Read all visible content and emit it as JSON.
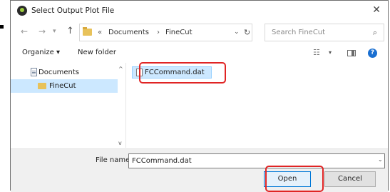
{
  "window": {
    "title": "Select Output Plot File"
  },
  "address_bar": {
    "prefix": "«",
    "breadcrumb": [
      "Documents",
      "FineCut"
    ],
    "separator": "›"
  },
  "search": {
    "placeholder": "Search FineCut"
  },
  "toolbar": {
    "organize_label": "Organize ▾",
    "new_folder_label": "New folder"
  },
  "navigation_pane": {
    "items": [
      {
        "label": "Documents",
        "icon": "documents-icon"
      },
      {
        "label": "FineCut",
        "icon": "folder-icon",
        "selected": true
      }
    ]
  },
  "file_list": {
    "items": [
      {
        "label": "FCCommand.dat",
        "selected": true
      }
    ]
  },
  "footer": {
    "file_name_label": "File name:",
    "file_name_value": "FCCommand.dat",
    "open_label": "Open",
    "cancel_label": "Cancel"
  },
  "highlight_color": "#e02424",
  "selection_color": "#cce8ff"
}
